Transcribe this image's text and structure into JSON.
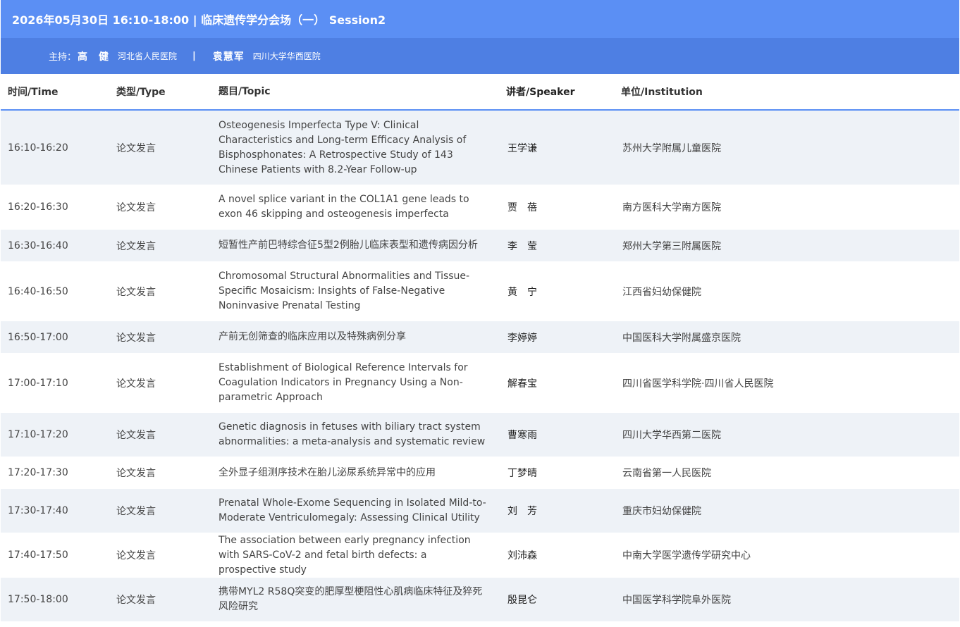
{
  "session": {
    "title": "2026年05月30日 16:10-18:00 | 临床遗传学分会场（一） Session2",
    "host_label": "主持：",
    "hosts": [
      {
        "name": "高　健",
        "org": "河北省人民医院"
      },
      {
        "name": "袁慧军",
        "org": "四川大学华西医院"
      }
    ],
    "separator": "|"
  },
  "table": {
    "headers": {
      "time": "时间/Time",
      "type": "类型/Type",
      "topic": "题目/Topic",
      "speaker": "讲者/Speaker",
      "institution": "单位/Institution"
    },
    "rows": [
      {
        "time": "16:10-16:20",
        "type": "论文发言",
        "topic": "Osteogenesis Imperfecta Type V: Clinical Characteristics and Long-term Efficacy Analysis of Bisphosphonates: A Retrospective Study of 143 Chinese Patients with 8.2-Year Follow-up",
        "speaker": "王学谦",
        "institution": "苏州大学附属儿童医院"
      },
      {
        "time": "16:20-16:30",
        "type": "论文发言",
        "topic": "A novel splice variant in the COL1A1 gene leads to exon 46 skipping and osteogenesis imperfecta",
        "speaker": "贾　蓓",
        "institution": "南方医科大学南方医院"
      },
      {
        "time": "16:30-16:40",
        "type": "论文发言",
        "topic": "短暂性产前巴特综合征5型2例胎儿临床表型和遗传病因分析",
        "speaker": "李　莹",
        "institution": "郑州大学第三附属医院"
      },
      {
        "time": "16:40-16:50",
        "type": "论文发言",
        "topic": "Chromosomal Structural Abnormalities and Tissue-Specific Mosaicism: Insights of False-Negative Noninvasive Prenatal Testing",
        "speaker": "黄　宁",
        "institution": "江西省妇幼保健院"
      },
      {
        "time": "16:50-17:00",
        "type": "论文发言",
        "topic": "产前无创筛查的临床应用以及特殊病例分享",
        "speaker": "李婷婷",
        "institution": "中国医科大学附属盛京医院"
      },
      {
        "time": "17:00-17:10",
        "type": "论文发言",
        "topic": "Establishment of Biological Reference Intervals for Coagulation Indicators in Pregnancy Using a Non-parametric Approach",
        "speaker": "解春宝",
        "institution": "四川省医学科学院·四川省人民医院"
      },
      {
        "time": "17:10-17:20",
        "type": "论文发言",
        "topic": "Genetic diagnosis in fetuses with biliary tract system abnormalities: a meta-analysis and systematic review",
        "speaker": "曹寒雨",
        "institution": "四川大学华西第二医院"
      },
      {
        "time": "17:20-17:30",
        "type": "论文发言",
        "topic": "全外显子组测序技术在胎儿泌尿系统异常中的应用",
        "speaker": "丁梦晴",
        "institution": "云南省第一人民医院"
      },
      {
        "time": "17:30-17:40",
        "type": "论文发言",
        "topic": "Prenatal Whole-Exome Sequencing in Isolated Mild-to-Moderate Ventriculomegaly: Assessing Clinical Utility",
        "speaker": "刘　芳",
        "institution": "重庆市妇幼保健院"
      },
      {
        "time": "17:40-17:50",
        "type": "论文发言",
        "topic": "The association between early pregnancy infection with SARS-CoV-2 and fetal birth defects: a prospective study",
        "speaker": "刘沛森",
        "institution": "中南大学医学遗传学研究中心"
      },
      {
        "time": "17:50-18:00",
        "type": "论文发言",
        "topic": "携带MYL2 R58Q突变的肥厚型梗阻性心肌病临床特征及猝死风险研究",
        "speaker": "殷昆仑",
        "institution": "中国医学科学院阜外医院"
      }
    ]
  }
}
